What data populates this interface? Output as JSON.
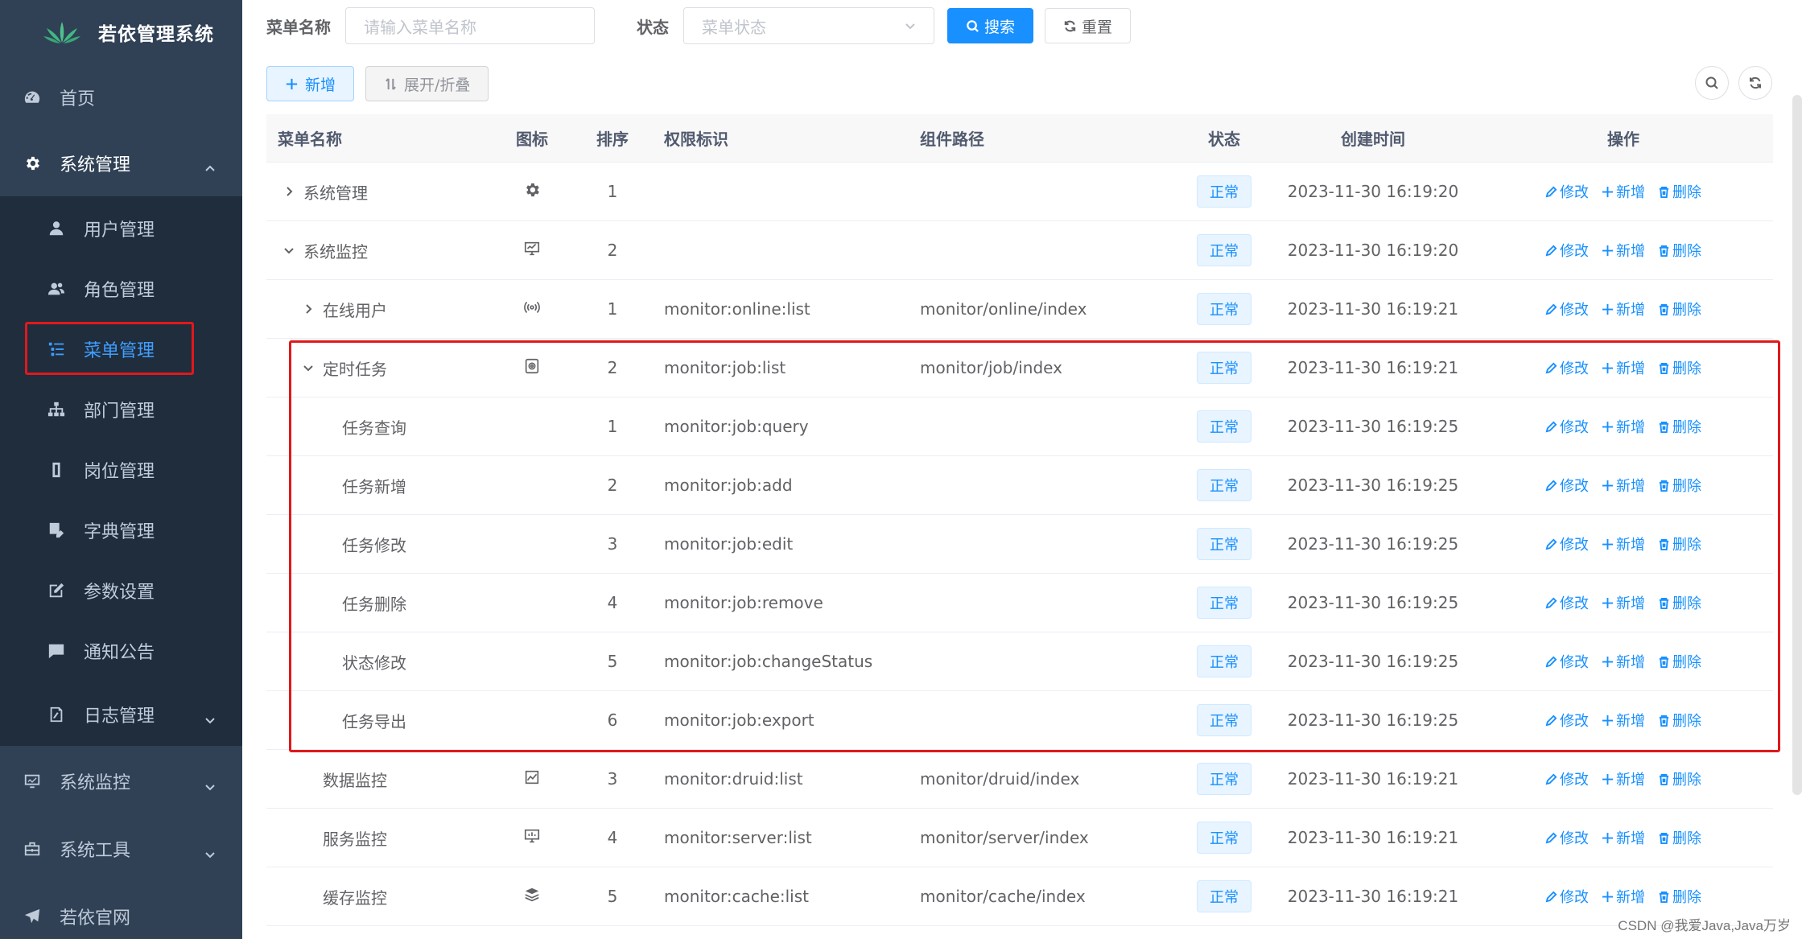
{
  "app": {
    "title": "若依管理系统"
  },
  "sidebar": {
    "items": [
      {
        "label": "首页",
        "icon": "dashboard-icon"
      },
      {
        "label": "系统管理",
        "icon": "gear-icon"
      },
      {
        "label": "用户管理",
        "icon": "user-icon"
      },
      {
        "label": "角色管理",
        "icon": "users-icon"
      },
      {
        "label": "菜单管理",
        "icon": "tree-list-icon"
      },
      {
        "label": "部门管理",
        "icon": "org-tree-icon"
      },
      {
        "label": "岗位管理",
        "icon": "post-icon"
      },
      {
        "label": "字典管理",
        "icon": "dict-icon"
      },
      {
        "label": "参数设置",
        "icon": "edit-icon"
      },
      {
        "label": "通知公告",
        "icon": "message-icon"
      },
      {
        "label": "日志管理",
        "icon": "log-icon"
      },
      {
        "label": "系统监控",
        "icon": "monitor-icon"
      },
      {
        "label": "系统工具",
        "icon": "toolbox-icon"
      },
      {
        "label": "若依官网",
        "icon": "send-icon"
      }
    ]
  },
  "search": {
    "name_label": "菜单名称",
    "name_placeholder": "请输入菜单名称",
    "status_label": "状态",
    "status_placeholder": "菜单状态",
    "search_button": "搜索",
    "reset_button": "重置"
  },
  "toolbar": {
    "add_label": "新增",
    "expand_label": "展开/折叠"
  },
  "table": {
    "headers": {
      "name": "菜单名称",
      "icon": "图标",
      "order": "排序",
      "perm": "权限标识",
      "component": "组件路径",
      "status": "状态",
      "created": "创建时间",
      "ops": "操作"
    },
    "ops": {
      "edit": "修改",
      "add": "新增",
      "delete": "删除"
    },
    "rows": [
      {
        "name": "系统管理",
        "icon": "gear-icon",
        "order": "1",
        "perm": "",
        "component": "",
        "status": "正常",
        "created": "2023-11-30 16:19:20"
      },
      {
        "name": "系统监控",
        "icon": "monitor-icon",
        "order": "2",
        "perm": "",
        "component": "",
        "status": "正常",
        "created": "2023-11-30 16:19:20"
      },
      {
        "name": "在线用户",
        "icon": "online-icon",
        "order": "1",
        "perm": "monitor:online:list",
        "component": "monitor/online/index",
        "status": "正常",
        "created": "2023-11-30 16:19:21"
      },
      {
        "name": "定时任务",
        "icon": "job-icon",
        "order": "2",
        "perm": "monitor:job:list",
        "component": "monitor/job/index",
        "status": "正常",
        "created": "2023-11-30 16:19:21"
      },
      {
        "name": "任务查询",
        "icon": "",
        "order": "1",
        "perm": "monitor:job:query",
        "component": "",
        "status": "正常",
        "created": "2023-11-30 16:19:25"
      },
      {
        "name": "任务新增",
        "icon": "",
        "order": "2",
        "perm": "monitor:job:add",
        "component": "",
        "status": "正常",
        "created": "2023-11-30 16:19:25"
      },
      {
        "name": "任务修改",
        "icon": "",
        "order": "3",
        "perm": "monitor:job:edit",
        "component": "",
        "status": "正常",
        "created": "2023-11-30 16:19:25"
      },
      {
        "name": "任务删除",
        "icon": "",
        "order": "4",
        "perm": "monitor:job:remove",
        "component": "",
        "status": "正常",
        "created": "2023-11-30 16:19:25"
      },
      {
        "name": "状态修改",
        "icon": "",
        "order": "5",
        "perm": "monitor:job:changeStatus",
        "component": "",
        "status": "正常",
        "created": "2023-11-30 16:19:25"
      },
      {
        "name": "任务导出",
        "icon": "",
        "order": "6",
        "perm": "monitor:job:export",
        "component": "",
        "status": "正常",
        "created": "2023-11-30 16:19:25"
      },
      {
        "name": "数据监控",
        "icon": "druid-icon",
        "order": "3",
        "perm": "monitor:druid:list",
        "component": "monitor/druid/index",
        "status": "正常",
        "created": "2023-11-30 16:19:21"
      },
      {
        "name": "服务监控",
        "icon": "server-icon",
        "order": "4",
        "perm": "monitor:server:list",
        "component": "monitor/server/index",
        "status": "正常",
        "created": "2023-11-30 16:19:21"
      },
      {
        "name": "缓存监控",
        "icon": "cache-icon",
        "order": "5",
        "perm": "monitor:cache:list",
        "component": "monitor/cache/index",
        "status": "正常",
        "created": "2023-11-30 16:19:21"
      }
    ]
  },
  "colors": {
    "sidebar_bg": "#304156",
    "submenu_bg": "#1f2d3d",
    "primary": "#1890ff",
    "highlight": "#e0191b"
  },
  "watermark": "CSDN @我爱Java,Java万岁"
}
